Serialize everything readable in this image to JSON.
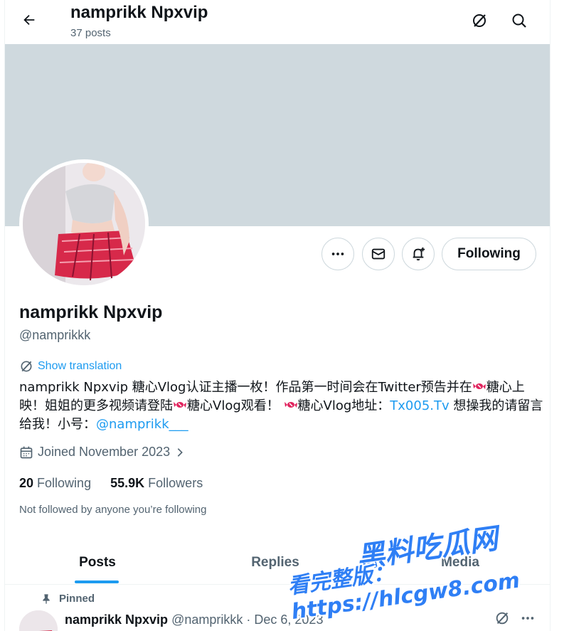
{
  "header": {
    "title": "namprikk Npxvip",
    "post_count": "37 posts"
  },
  "profile": {
    "name": "namprikk Npxvip",
    "handle": "@namprikkk",
    "follow_state": "Following",
    "show_translation": "Show translation",
    "bio": {
      "part1": "namprikk Npxvip 糖心Vlog认证主播一枚！作品第一时间会在Twitter预告并在",
      "part2": "糖心上映！姐姐的更多视频请登陆",
      "part3": "糖心Vlog观看！",
      "part4": "糖心Vlog地址：",
      "link1": "Tx005.Tv",
      "part5": " 想操我的请留言给我！小号：",
      "link2": "@namprikk___"
    },
    "joined": "Joined November 2023",
    "following_count": "20",
    "following_label": "Following",
    "followers_count": "55.9K",
    "followers_label": "Followers",
    "not_followed": "Not followed by anyone you’re following"
  },
  "tabs": [
    {
      "label": "Posts",
      "active": true
    },
    {
      "label": "Replies",
      "active": false
    },
    {
      "label": "Media",
      "active": false
    }
  ],
  "pinned_post": {
    "pinned_label": "Pinned",
    "author_name": "namprikk Npxvip",
    "author_handle": "@namprikkk",
    "separator": "·",
    "date": "Dec 6, 2023"
  },
  "watermark": {
    "line1": "黑料吃瓜网",
    "line2": "看完整版：https://hlcgw8.com"
  },
  "colors": {
    "accent": "#1d9bf0",
    "banner": "#cfd9de",
    "secondary_text": "#536471"
  },
  "icons": [
    "back-arrow-icon",
    "grok-icon",
    "search-icon",
    "more-icon",
    "mail-icon",
    "bell-plus-icon",
    "calendar-icon",
    "chevron-right-icon",
    "pin-icon",
    "candy-icon"
  ]
}
